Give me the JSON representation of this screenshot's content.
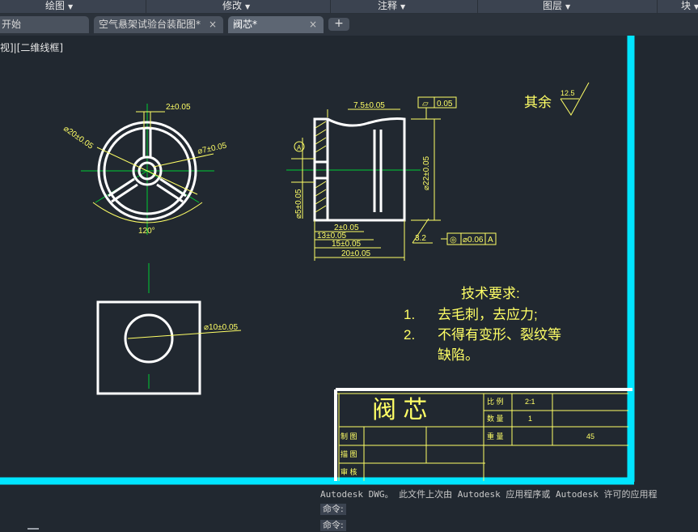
{
  "ribbon": {
    "items": [
      "绘图",
      "修改",
      "注释",
      "图层",
      "块"
    ]
  },
  "tabs": {
    "items": [
      {
        "label": "开始",
        "active": false,
        "closable": false
      },
      {
        "label": "空气悬架试验台装配图*",
        "active": false,
        "closable": true
      },
      {
        "label": "阀芯*",
        "active": true,
        "closable": true
      }
    ],
    "close_glyph": "×",
    "add_glyph": "+"
  },
  "viewport": {
    "label": "视]|[二维线框]"
  },
  "drawing": {
    "colors": {
      "background": "#212830",
      "frame": "#00e5ff",
      "geometry": "#ffffff",
      "dimension": "#ffff66",
      "centerline": "#00cc33"
    },
    "front_view": {
      "dim_width": "2±0.05",
      "dim_outer": "⌀20±0.05",
      "dim_inner": "⌀7±0.05",
      "dim_angle": "120°"
    },
    "section_view": {
      "dim_top": "7.5±0.05",
      "tol_frame_top": [
        "⏥",
        "0.05"
      ],
      "datum_label": "A",
      "dim_height": "⌀22±0.05",
      "dim_left": "⌀5±0.05",
      "dims_bottom": [
        "2±0.05",
        "13±0.05",
        "15±0.05",
        "20±0.05"
      ],
      "roughness_value": "3.2",
      "tol_frame_bottom": [
        "◎",
        "⌀0.06",
        "A"
      ]
    },
    "top_view": {
      "dim_hole": "⌀10±0.05"
    },
    "surface_finish": {
      "label": "其余",
      "value": "12.5"
    },
    "notes": {
      "title": "技术要求:",
      "lines": [
        {
          "num": "1.",
          "text": "去毛刺，去应力;"
        },
        {
          "num": "2.",
          "text": "不得有变形、裂纹等"
        },
        {
          "num": "",
          "text": "缺陷。"
        }
      ]
    },
    "title_block": {
      "part_name": "阀   芯",
      "scale_label": "比 例",
      "scale_value": "2:1",
      "qty_label": "数 量",
      "qty_value": "1",
      "weight_label": "重 量",
      "material_value": "45",
      "drawn_label": "制 图",
      "traced_label": "描 图",
      "checked_label": "审 核"
    }
  },
  "command": {
    "message": "Autodesk DWG。  此文件上次由 Autodesk 应用程序或 Autodesk 许可的应用程",
    "prompts": [
      "命令:",
      "命令:"
    ]
  }
}
